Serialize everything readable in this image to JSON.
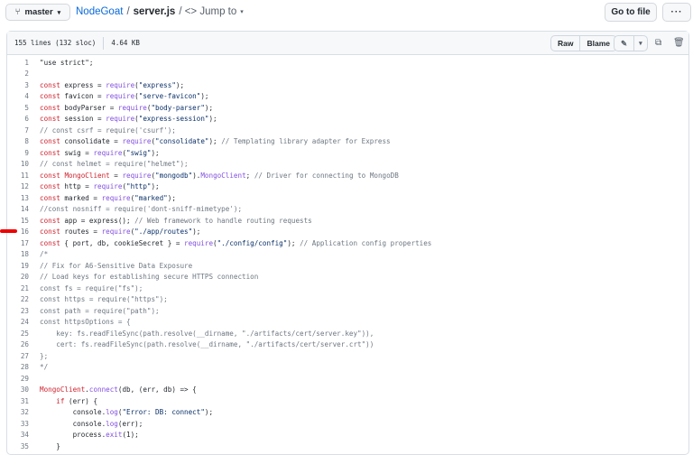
{
  "nav": {
    "branch": "master",
    "repo": "NodeGoat",
    "sep": "/",
    "file": "server.js",
    "jump": "/ <> Jump to",
    "goto": "Go to file",
    "more": "···"
  },
  "file_header": {
    "lines": "155 lines (132 sloc)",
    "size": "4.64 KB",
    "raw": "Raw",
    "blame": "Blame",
    "edit_icon": "pencil-icon",
    "copy_icon": "copy-icon",
    "delete_icon": "trash-icon"
  },
  "code": [
    [
      [
        "p",
        "\"use strict\";"
      ]
    ],
    [],
    [
      [
        "k",
        "const"
      ],
      [
        "p",
        " express = "
      ],
      [
        "f",
        "require"
      ],
      [
        "p",
        "("
      ],
      [
        "s",
        "\"express\""
      ],
      [
        "p",
        ");"
      ]
    ],
    [
      [
        "k",
        "const"
      ],
      [
        "p",
        " favicon = "
      ],
      [
        "f",
        "require"
      ],
      [
        "p",
        "("
      ],
      [
        "s",
        "\"serve-favicon\""
      ],
      [
        "p",
        ");"
      ]
    ],
    [
      [
        "k",
        "const"
      ],
      [
        "p",
        " bodyParser = "
      ],
      [
        "f",
        "require"
      ],
      [
        "p",
        "("
      ],
      [
        "s",
        "\"body-parser\""
      ],
      [
        "p",
        ");"
      ]
    ],
    [
      [
        "k",
        "const"
      ],
      [
        "p",
        " session = "
      ],
      [
        "f",
        "require"
      ],
      [
        "p",
        "("
      ],
      [
        "s",
        "\"express-session\""
      ],
      [
        "p",
        ");"
      ]
    ],
    [
      [
        "c",
        "// const csrf = require('csurf');"
      ]
    ],
    [
      [
        "k",
        "const"
      ],
      [
        "p",
        " consolidate = "
      ],
      [
        "f",
        "require"
      ],
      [
        "p",
        "("
      ],
      [
        "s",
        "\"consolidate\""
      ],
      [
        "p",
        "); "
      ],
      [
        "c",
        "// Templating library adapter for Express"
      ]
    ],
    [
      [
        "k",
        "const"
      ],
      [
        "p",
        " swig = "
      ],
      [
        "f",
        "require"
      ],
      [
        "p",
        "("
      ],
      [
        "s",
        "\"swig\""
      ],
      [
        "p",
        ");"
      ]
    ],
    [
      [
        "c",
        "// const helmet = require(\"helmet\");"
      ]
    ],
    [
      [
        "k",
        "const"
      ],
      [
        "p",
        " "
      ],
      [
        "k",
        "MongoClient"
      ],
      [
        "p",
        " = "
      ],
      [
        "f",
        "require"
      ],
      [
        "p",
        "("
      ],
      [
        "s",
        "\"mongodb\""
      ],
      [
        "p",
        ")."
      ],
      [
        "f",
        "MongoClient"
      ],
      [
        "p",
        "; "
      ],
      [
        "c",
        "// Driver for connecting to MongoDB"
      ]
    ],
    [
      [
        "k",
        "const"
      ],
      [
        "p",
        " http = "
      ],
      [
        "f",
        "require"
      ],
      [
        "p",
        "("
      ],
      [
        "s",
        "\"http\""
      ],
      [
        "p",
        ");"
      ]
    ],
    [
      [
        "k",
        "const"
      ],
      [
        "p",
        " marked = "
      ],
      [
        "f",
        "require"
      ],
      [
        "p",
        "("
      ],
      [
        "s",
        "\"marked\""
      ],
      [
        "p",
        ");"
      ]
    ],
    [
      [
        "c",
        "//const nosniff = require('dont-sniff-mimetype');"
      ]
    ],
    [
      [
        "k",
        "const"
      ],
      [
        "p",
        " app = express(); "
      ],
      [
        "c",
        "// Web framework to handle routing requests"
      ]
    ],
    [
      [
        "k",
        "const"
      ],
      [
        "p",
        " routes = "
      ],
      [
        "f",
        "require"
      ],
      [
        "p",
        "("
      ],
      [
        "s",
        "\"./app/routes\""
      ],
      [
        "p",
        ");"
      ]
    ],
    [
      [
        "k",
        "const"
      ],
      [
        "p",
        " { port, db, cookieSecret } = "
      ],
      [
        "f",
        "require"
      ],
      [
        "p",
        "("
      ],
      [
        "s",
        "\"./config/config\""
      ],
      [
        "p",
        "); "
      ],
      [
        "c",
        "// Application config properties"
      ]
    ],
    [
      [
        "c",
        "/*"
      ]
    ],
    [
      [
        "c",
        "// Fix for A6-Sensitive Data Exposure"
      ]
    ],
    [
      [
        "c",
        "// Load keys for establishing secure HTTPS connection"
      ]
    ],
    [
      [
        "c",
        "const fs = require(\"fs\");"
      ]
    ],
    [
      [
        "c",
        "const https = require(\"https\");"
      ]
    ],
    [
      [
        "c",
        "const path = require(\"path\");"
      ]
    ],
    [
      [
        "c",
        "const httpsOptions = {"
      ]
    ],
    [
      [
        "c",
        "    key: fs.readFileSync(path.resolve(__dirname, \"./artifacts/cert/server.key\")),"
      ]
    ],
    [
      [
        "c",
        "    cert: fs.readFileSync(path.resolve(__dirname, \"./artifacts/cert/server.crt\"))"
      ]
    ],
    [
      [
        "c",
        "};"
      ]
    ],
    [
      [
        "c",
        "*/"
      ]
    ],
    [],
    [
      [
        "k",
        "MongoClient"
      ],
      [
        "p",
        "."
      ],
      [
        "f",
        "connect"
      ],
      [
        "p",
        "(db, (err, db) => {"
      ]
    ],
    [
      [
        "p",
        "    "
      ],
      [
        "k",
        "if"
      ],
      [
        "p",
        " (err) {"
      ]
    ],
    [
      [
        "p",
        "        console."
      ],
      [
        "f",
        "log"
      ],
      [
        "p",
        "("
      ],
      [
        "s",
        "\"Error: DB: connect\""
      ],
      [
        "p",
        ");"
      ]
    ],
    [
      [
        "p",
        "        console."
      ],
      [
        "f",
        "log"
      ],
      [
        "p",
        "(err);"
      ]
    ],
    [
      [
        "p",
        "        process."
      ],
      [
        "f",
        "exit"
      ],
      [
        "p",
        "(1);"
      ]
    ],
    [
      [
        "p",
        "    }"
      ]
    ]
  ]
}
